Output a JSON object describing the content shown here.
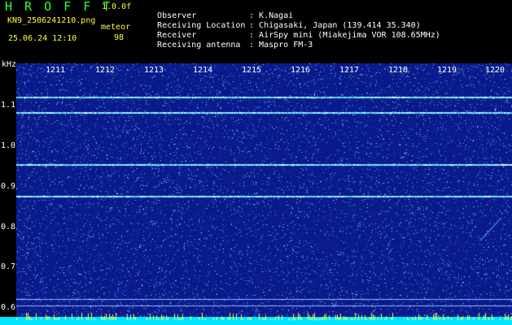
{
  "header": {
    "title": "H R O F F T",
    "version": "1.0.0f",
    "file_name": "KN9_2506241210.png",
    "mode_label": "meteor",
    "date_time": "25.06.24 12:10",
    "mode_value": "98"
  },
  "info": [
    {
      "key": "Observer",
      "sep": ":",
      "value": "K.Nagai"
    },
    {
      "key": "Receiving Location",
      "sep": ":",
      "value": "Chigasaki, Japan (139.414 35.340)"
    },
    {
      "key": "Receiver",
      "sep": ":",
      "value": "AirSpy mini (Miakejima VOR 108.65MHz)"
    },
    {
      "key": "Receiving antenna",
      "sep": ":",
      "value": "Maspro FM-3"
    }
  ],
  "axis": {
    "y_unit": "kHz",
    "y_ticks": [
      "1.1",
      "1.0",
      "0.9",
      "0.8",
      "0.7",
      "0.6"
    ],
    "x_ticks": [
      "1211",
      "1212",
      "1213",
      "1214",
      "1215",
      "1216",
      "1217",
      "1218",
      "1219",
      "1220"
    ]
  },
  "spectrogram": {
    "background_color": "#0a1a8a",
    "noise_color": "#4aa8ff",
    "line_color": "#7ff0ff",
    "bottom_bar_color": "#00e5ff",
    "spike_color": "#ffff44",
    "carrier_freqs_khz": [
      1.115,
      1.078,
      0.951,
      0.874,
      0.621,
      0.605
    ]
  },
  "colors": {
    "title_green": "#33ff33",
    "accent_yellow": "#ffff33",
    "text_white": "#ffffff"
  }
}
